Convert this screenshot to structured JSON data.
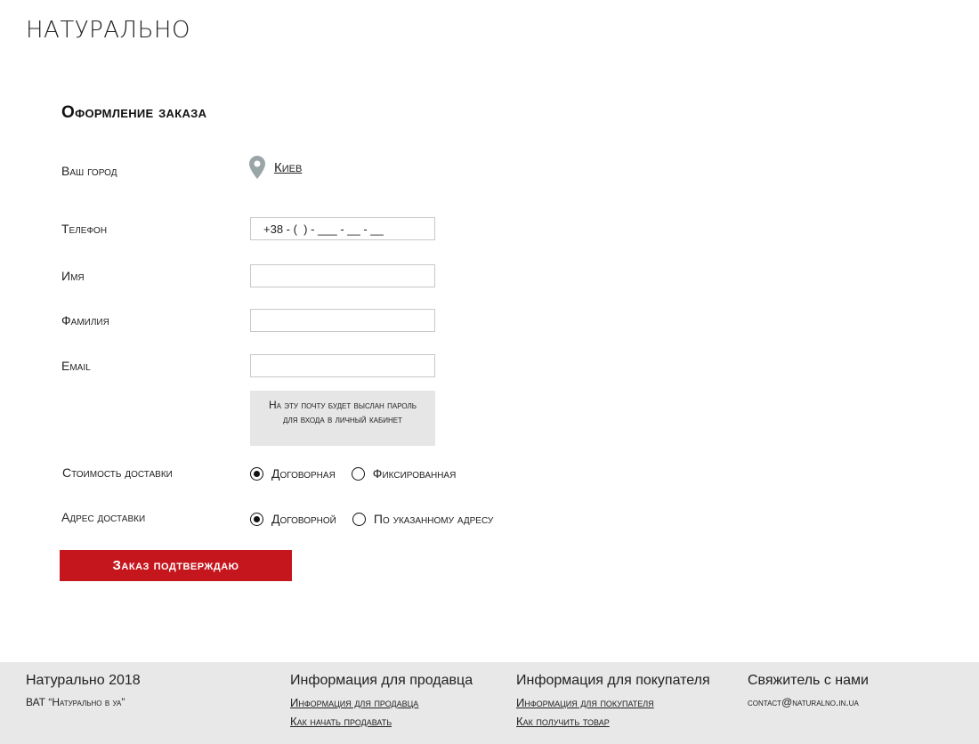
{
  "header": {
    "logo": "НАТУРАЛЬНО"
  },
  "form": {
    "title": "Оформление заказа",
    "city": {
      "label": "Ваш город",
      "value": "Киев",
      "icon": "map-pin-icon"
    },
    "phone": {
      "label": "Телефон",
      "value": "+38 - (  ) - ___ - __ - __"
    },
    "first_name": {
      "label": "Имя",
      "value": ""
    },
    "last_name": {
      "label": "Фамилия",
      "value": ""
    },
    "email": {
      "label": "Email",
      "value": "",
      "hint": "На эту почту будет выслан пароль для входа в личный кабинет"
    },
    "delivery_cost": {
      "label": "Стоимость доставки",
      "options": [
        {
          "label": "Договорная",
          "selected": true
        },
        {
          "label": "Фиксированная",
          "selected": false
        }
      ]
    },
    "delivery_address": {
      "label": "Адрес доставки",
      "options": [
        {
          "label": "Договорной",
          "selected": true
        },
        {
          "label": "По указанному адресу",
          "selected": false
        }
      ]
    },
    "submit_label": "Заказ подтверждаю"
  },
  "footer": {
    "brand": {
      "title": "Натурально 2018",
      "subtitle": "ВАТ “Натурально в уа”"
    },
    "seller": {
      "title": "Информация для продавца",
      "links": [
        "Информация для продавца",
        "Как начать продавать"
      ]
    },
    "buyer": {
      "title": "Информация для покупателя",
      "links": [
        "Информация для покупателя",
        "Как получить товар"
      ]
    },
    "contact": {
      "title": "Свяжитель с нами",
      "email": "contact@naturalno.in.ua"
    }
  },
  "colors": {
    "accent": "#c4161c",
    "footer_bg": "#e8e8e8",
    "hint_bg": "#e6e6e6",
    "pin": "#9aa5a8"
  }
}
